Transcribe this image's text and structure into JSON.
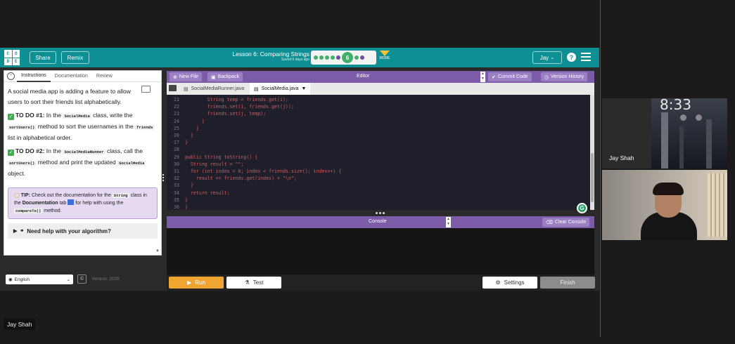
{
  "topbar": {
    "logo_letters": [
      "C",
      "O",
      "D",
      "E"
    ],
    "share_label": "Share",
    "remix_label": "Remix",
    "lesson_title": "Lesson 6: Comparing Strings",
    "saved_text": "Saved 6 days ago",
    "current_level": "6",
    "more_label": "MORE",
    "user_label": "Jay",
    "help_label": "?"
  },
  "left_tabs": [
    "Instructions",
    "Documentation",
    "Review"
  ],
  "instructions": {
    "intro": "A social media app is adding a feature to allow users to sort their friends list alphabetically.",
    "todo1_label": "TO DO #1:",
    "todo1_a": "In the",
    "todo1_code1": "SocialMedia",
    "todo1_b": "class, write the",
    "todo1_code2": "sortUsers()",
    "todo1_c": "method to sort the usernames in the",
    "todo1_code3": "friends",
    "todo1_d": "list in alphabetical order.",
    "todo2_label": "TO DO #2:",
    "todo2_a": "In the",
    "todo2_code1": "SocialMediaRunner",
    "todo2_b": "class, call the",
    "todo2_code2": "sortUsers()",
    "todo2_c": "method and print the updated",
    "todo2_code3": "SocialMedia",
    "todo2_d": "object.",
    "tip_label": "TIP:",
    "tip_a": "Check out the documentation for the",
    "tip_code1": "String",
    "tip_b": "class in the",
    "tip_bold": "Documentation",
    "tip_c": "tab",
    "tip_d": "for help with using the",
    "tip_code2": "compareTo()",
    "tip_e": "method.",
    "help_text": "Need help with your algorithm?"
  },
  "editor": {
    "new_file": "New File",
    "backpack": "Backpack",
    "title": "Editor",
    "commit": "Commit Code",
    "history": "Version History",
    "tabs": [
      "SocialMediaRunner.java",
      "SocialMedia.java"
    ],
    "lines": [
      {
        "n": "21",
        "t": "        String temp = friends.get(i);"
      },
      {
        "n": "22",
        "t": "        friends.set(i, friends.get(j));"
      },
      {
        "n": "23",
        "t": "        friends.set(j, temp);"
      },
      {
        "n": "24",
        "t": "      }"
      },
      {
        "n": "25",
        "t": "    }"
      },
      {
        "n": "26",
        "t": "  }"
      },
      {
        "n": "27",
        "t": "}"
      },
      {
        "n": "28",
        "t": ""
      },
      {
        "n": "29",
        "t": "public String toString() {"
      },
      {
        "n": "30",
        "t": "  String result = \"\";"
      },
      {
        "n": "31",
        "t": "  for (int index = 0; index < friends.size(); index++) {"
      },
      {
        "n": "32",
        "t": "    result += friends.get(index) + \"\\n\";"
      },
      {
        "n": "33",
        "t": "  }"
      },
      {
        "n": "34",
        "t": "  return result;"
      },
      {
        "n": "35",
        "t": "}"
      },
      {
        "n": "36",
        "t": "}"
      }
    ]
  },
  "console": {
    "title": "Console",
    "clear": "Clear Console"
  },
  "bottom": {
    "run": "Run",
    "test": "Test",
    "settings": "Settings",
    "finish": "Finish"
  },
  "footer": {
    "language": "English",
    "version": "Version: 2025"
  },
  "participants": {
    "self_name": "Jay Shah",
    "tile_name": "Jay Shah",
    "clock": "8:33"
  },
  "colors": {
    "teal": "#0e8f93",
    "purple": "#7c5ba8",
    "run_orange": "#f0a530"
  }
}
